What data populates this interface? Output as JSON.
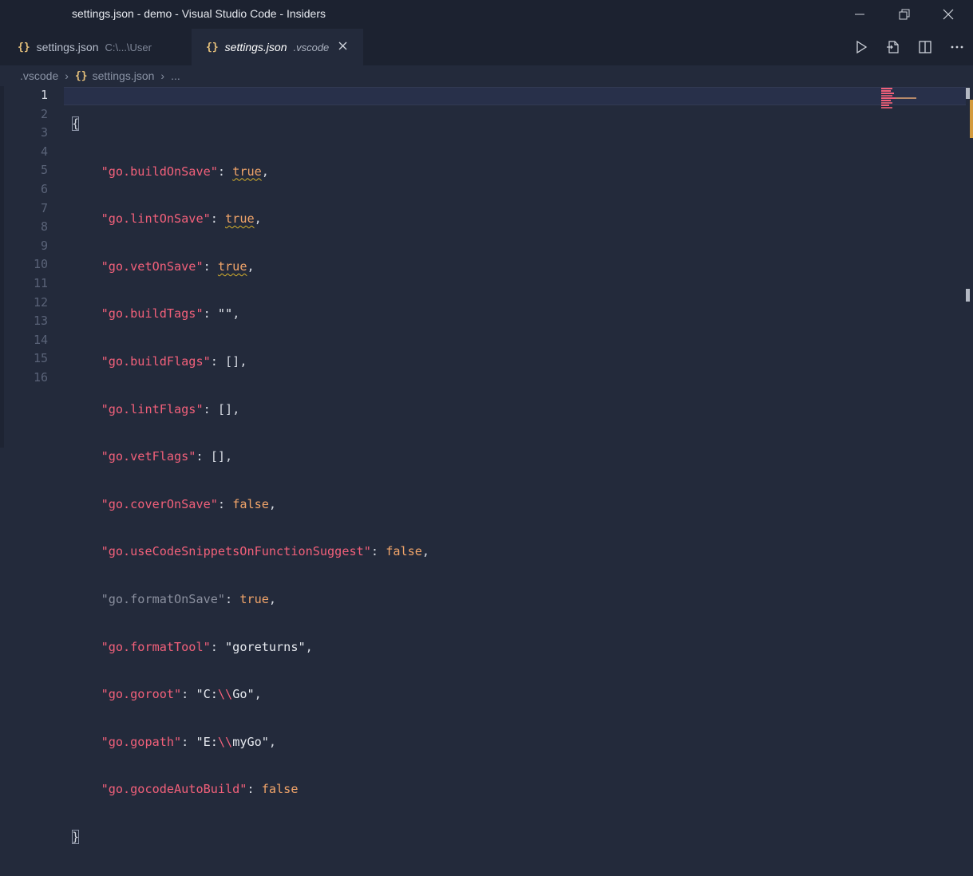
{
  "window": {
    "title": "settings.json - demo - Visual Studio Code - Insiders"
  },
  "tabs": [
    {
      "icon": "{}",
      "name": "settings.json",
      "description": "C:\\...\\User"
    },
    {
      "icon": "{}",
      "name": "settings.json",
      "description": ".vscode"
    }
  ],
  "breadcrumb": {
    "folder": ".vscode",
    "file_icon": "{}",
    "file": "settings.json",
    "ellipsis": "..."
  },
  "editor": {
    "line_numbers": [
      "1",
      "2",
      "3",
      "4",
      "5",
      "6",
      "7",
      "8",
      "9",
      "10",
      "11",
      "12",
      "13",
      "14",
      "15",
      "16"
    ],
    "open_brace": "{",
    "close_brace": "}",
    "entries": [
      {
        "key": "\"go.buildOnSave\"",
        "value": "true",
        "suffix": ","
      },
      {
        "key": "\"go.lintOnSave\"",
        "value": "true",
        "suffix": ","
      },
      {
        "key": "\"go.vetOnSave\"",
        "value": "true",
        "suffix": ","
      },
      {
        "key": "\"go.buildTags\"",
        "value": "\"\"",
        "suffix": ","
      },
      {
        "key": "\"go.buildFlags\"",
        "value": "[]",
        "suffix": ","
      },
      {
        "key": "\"go.lintFlags\"",
        "value": "[]",
        "suffix": ","
      },
      {
        "key": "\"go.vetFlags\"",
        "value": "[]",
        "suffix": ","
      },
      {
        "key": "\"go.coverOnSave\"",
        "value": "false",
        "suffix": ","
      },
      {
        "key": "\"go.useCodeSnippetsOnFunctionSuggest\"",
        "value": "false",
        "suffix": ","
      },
      {
        "key": "\"go.formatOnSave\"",
        "value": "true",
        "suffix": ","
      },
      {
        "key": "\"go.formatTool\"",
        "value": "\"goreturns\"",
        "suffix": ","
      },
      {
        "key": "\"go.goroot\"",
        "value_prefix": "\"C:",
        "value_escape": "\\\\",
        "value_rest": "Go\"",
        "suffix": ","
      },
      {
        "key": "\"go.gopath\"",
        "value_prefix": "\"E:",
        "value_escape": "\\\\",
        "value_rest": "myGo\"",
        "suffix": ","
      },
      {
        "key": "\"go.gocodeAutoBuild\"",
        "value": "false",
        "suffix": ""
      }
    ]
  },
  "colors": {
    "background": "#232a3b",
    "titlebar": "#1c2230",
    "key": "#f2607a",
    "boolean": "#f2a56a",
    "warning_squiggle": "#d8b22c",
    "scroll_marker": "#d39a3c"
  }
}
